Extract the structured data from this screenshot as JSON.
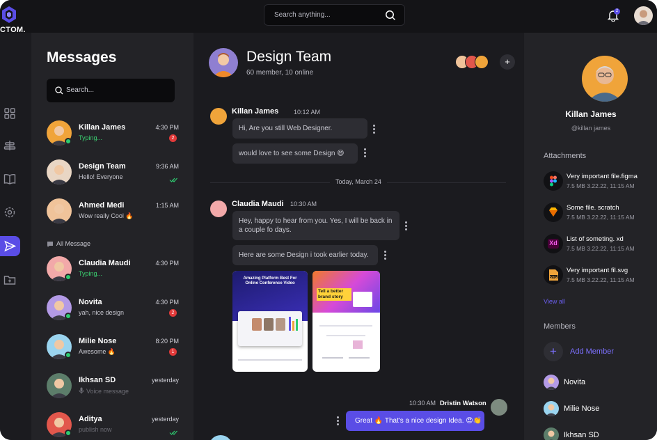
{
  "app": {
    "logo_text": "CTOM."
  },
  "topbar": {
    "search_placeholder": "Search anything...",
    "notification_count": "2"
  },
  "messages_panel": {
    "title": "Messages",
    "search_placeholder": "Search...",
    "all_message_label": "All Message",
    "pinned": [
      {
        "name": "Killan James",
        "subtitle": "Typing...",
        "time": "4:30 PM",
        "badge": "2",
        "online": true,
        "typing": true,
        "avatar_bg": "#f0a43a"
      },
      {
        "name": "Design Team",
        "subtitle": "Hello! Everyone",
        "time": "9:36 AM",
        "read": true,
        "avatar_bg": "#e9d6c4"
      },
      {
        "name": "Ahmed Medi",
        "subtitle": "Wow really Cool 🔥",
        "time": "1:15 AM",
        "avatar_bg": "#f0c39a"
      }
    ],
    "all": [
      {
        "name": "Claudia Maudi",
        "subtitle": "Typing...",
        "time": "4:30 PM",
        "online": true,
        "typing": true,
        "avatar_bg": "#f2a9a9"
      },
      {
        "name": "Novita",
        "subtitle": "yah, nice design",
        "time": "4:30 PM",
        "badge": "2",
        "online": true,
        "avatar_bg": "#b39ae6"
      },
      {
        "name": "Milie Nose",
        "subtitle": "Awesome 🔥",
        "time": "8:20 PM",
        "badge": "1",
        "online": true,
        "avatar_bg": "#9ad4ef"
      },
      {
        "name": "Ikhsan SD",
        "subtitle": "Voice message",
        "time": "yesterday",
        "voice": true,
        "avatar_bg": "#5c7d6a"
      },
      {
        "name": "Aditya",
        "subtitle": "publish now",
        "time": "yesterday",
        "online": true,
        "read": true,
        "avatar_bg": "#e2574c"
      }
    ]
  },
  "chat": {
    "title": "Design Team",
    "subtitle": "60 member, 10 online",
    "thread1": {
      "sender": "Killan James",
      "time": "10:12 AM",
      "bubbles": [
        "Hi, Are you still Web Designer.",
        "would love to see some Design 😄"
      ]
    },
    "date_divider": "Today, March 24",
    "thread2": {
      "sender": "Claudia Maudi",
      "time": "10:30 AM",
      "bubbles": [
        "Hey, happy to hear from you. Yes, I will be back in a couple fo days.",
        "Here are some Design i took earlier today."
      ],
      "shot1_title": "Amazing Platform Best For Online Conference Video",
      "shot2_title": "Tell a better brand story"
    },
    "mine": {
      "sender": "Dristin Watson",
      "time": "10:30 AM",
      "text": "Great 🔥 That's a nice design Idea. 😍👏"
    }
  },
  "profile": {
    "name": "Killan James",
    "handle": "@killan james",
    "attachments_title": "Attachments",
    "attachments": [
      {
        "name": "Very important file.figma",
        "meta": "7.5 MB 3.22.22, 11:15 AM",
        "icon": "figma-icon"
      },
      {
        "name": "Some file. scratch",
        "meta": "7.5 MB 3.22.22, 11:15 AM",
        "icon": "sketch-icon"
      },
      {
        "name": "List of someting. xd",
        "meta": "7.5 MB 3.22.22, 11:15 AM",
        "icon": "xd-icon",
        "icon_text": "Xd"
      },
      {
        "name": "Very important fil.svg",
        "meta": "7.5 MB 3.22.22, 11:15 AM",
        "icon": "svg-icon",
        "icon_text": "SVG"
      }
    ],
    "view_all": "View all",
    "members_title": "Members",
    "add_member": "Add Member",
    "members": [
      {
        "name": "Novita",
        "avatar_bg": "#b39ae6"
      },
      {
        "name": "Milie Nose",
        "avatar_bg": "#9ad4ef"
      },
      {
        "name": "Ikhsan SD",
        "avatar_bg": "#5c7d6a"
      }
    ]
  },
  "colors": {
    "accent": "#5a4de6",
    "online": "#2ecc71",
    "badge": "#e23a3a"
  }
}
